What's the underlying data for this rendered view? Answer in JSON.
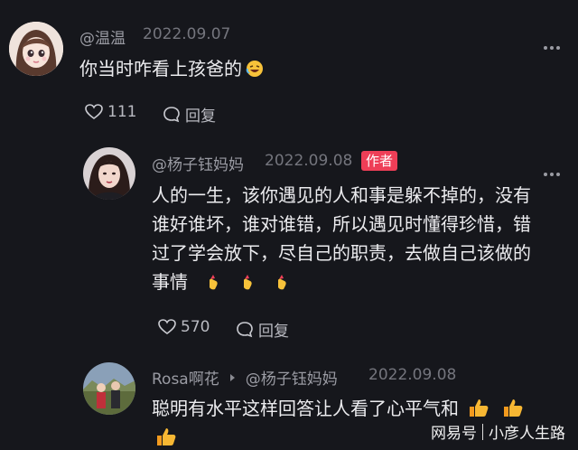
{
  "comments": [
    {
      "username": "@温温",
      "date": "2022.09.07",
      "text": "你当时咋看上孩爸的",
      "likes": "111",
      "reply_label": "回复"
    },
    {
      "username": "@杨子钰妈妈",
      "date": "2022.09.08",
      "badge": "作者",
      "text_lines": [
        "人的一生，该你遇见的人和事是躲不掉的，没有",
        "谁好谁坏，谁对谁错，所以遇见时懂得珍惜，错",
        "过了学会放下，尽自己的职责，去做自己该做的",
        "事情"
      ],
      "likes": "570",
      "reply_label": "回复"
    },
    {
      "username": "Rosa啊花",
      "reply_to": "@杨子钰妈妈",
      "date": "2022.09.08",
      "text": "聪明有水平这样回答让人看了心平气和"
    }
  ],
  "watermark": {
    "brand": "网易号",
    "author": "小彦人生路"
  }
}
